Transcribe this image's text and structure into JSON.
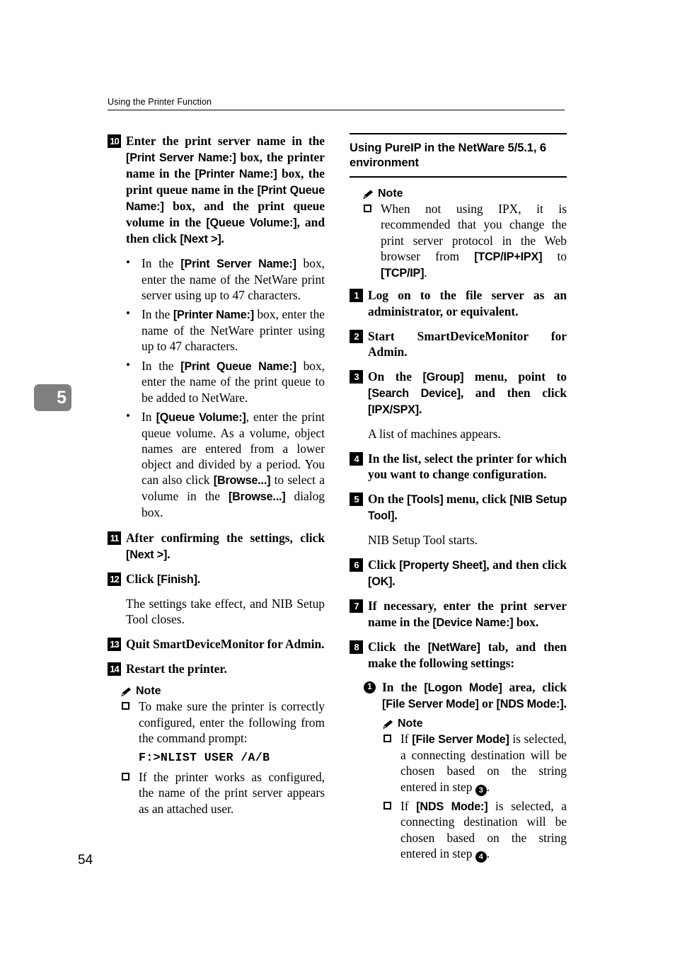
{
  "header": {
    "running_title": "Using the Printer Function"
  },
  "chapter_tab": {
    "number": "5"
  },
  "page_number": "54",
  "left_column": {
    "step10": {
      "badge": "10",
      "parts": [
        {
          "t": "Enter the print server name in the ",
          "s": "serif"
        },
        {
          "t": "[Print Server Name:]",
          "s": "ui"
        },
        {
          "t": " box, the printer name in the ",
          "s": "serif"
        },
        {
          "t": "[Printer Name:]",
          "s": "ui"
        },
        {
          "t": " box, the print queue name in the ",
          "s": "serif"
        },
        {
          "t": "[Print Queue Name:]",
          "s": "ui"
        },
        {
          "t": " box, and the print queue volume in the ",
          "s": "serif"
        },
        {
          "t": "[Queue Volume:]",
          "s": "ui"
        },
        {
          "t": ", and then click ",
          "s": "serif"
        },
        {
          "t": "[Next >]",
          "s": "ui"
        },
        {
          "t": ".",
          "s": "serif"
        }
      ]
    },
    "bullets": [
      [
        {
          "t": "In the ",
          "s": "serif"
        },
        {
          "t": "[Print Server Name:]",
          "s": "ui"
        },
        {
          "t": " box, enter the name of the NetWare print server using up to 47 characters.",
          "s": "serif"
        }
      ],
      [
        {
          "t": "In the ",
          "s": "serif"
        },
        {
          "t": "[Printer Name:]",
          "s": "ui"
        },
        {
          "t": " box, enter the name of the NetWare printer using up to 47 characters.",
          "s": "serif"
        }
      ],
      [
        {
          "t": "In the ",
          "s": "serif"
        },
        {
          "t": "[Print Queue Name:]",
          "s": "ui"
        },
        {
          "t": " box, enter the name of the print queue to be added to NetWare.",
          "s": "serif"
        }
      ],
      [
        {
          "t": "In ",
          "s": "serif"
        },
        {
          "t": "[Queue Volume:]",
          "s": "ui"
        },
        {
          "t": ", enter the print queue volume. As a volume, object names are entered from a lower object and divided by a period. You can also click ",
          "s": "serif"
        },
        {
          "t": "[Browse...]",
          "s": "ui"
        },
        {
          "t": " to select a volume in the ",
          "s": "serif"
        },
        {
          "t": "[Browse...]",
          "s": "ui"
        },
        {
          "t": " dialog box.",
          "s": "serif"
        }
      ]
    ],
    "step11": {
      "badge": "11",
      "parts": [
        {
          "t": "After confirming the settings, click ",
          "s": "serif"
        },
        {
          "t": "[Next >]",
          "s": "ui"
        },
        {
          "t": ".",
          "s": "serif"
        }
      ]
    },
    "step12": {
      "badge": "12",
      "parts": [
        {
          "t": "Click ",
          "s": "serif"
        },
        {
          "t": "[Finish]",
          "s": "ui"
        },
        {
          "t": ".",
          "s": "serif"
        }
      ],
      "result": "The settings take effect, and NIB Setup Tool closes."
    },
    "step13": {
      "badge": "13",
      "parts": [
        {
          "t": "Quit SmartDeviceMonitor for Admin.",
          "s": "serif"
        }
      ]
    },
    "step14": {
      "badge": "14",
      "parts": [
        {
          "t": "Restart the printer.",
          "s": "serif"
        }
      ]
    },
    "note": {
      "label": "Note",
      "icon": "pencil-icon",
      "items": [
        [
          {
            "t": "To make sure the printer is correctly configured, enter the following from the command prompt:",
            "s": "serif"
          }
        ],
        [
          {
            "t": "If the printer works as configured, the name of the print server appears as an attached user.",
            "s": "serif"
          }
        ]
      ],
      "command": "F:>NLIST USER /A/B"
    }
  },
  "right_column": {
    "heading": "Using PureIP in the NetWare 5/5.1, 6 environment",
    "note_top": {
      "label": "Note",
      "icon": "pencil-icon",
      "items": [
        [
          {
            "t": "When not using IPX, it is recommended that you change the print server protocol in the Web browser from ",
            "s": "serif"
          },
          {
            "t": "[TCP/IP+IPX]",
            "s": "ui"
          },
          {
            "t": " to ",
            "s": "serif"
          },
          {
            "t": "[TCP/IP]",
            "s": "ui"
          },
          {
            "t": ".",
            "s": "serif"
          }
        ]
      ]
    },
    "step1": {
      "badge": "1",
      "parts": [
        {
          "t": "Log on to the file server as an administrator, or equivalent.",
          "s": "serif"
        }
      ]
    },
    "step2": {
      "badge": "2",
      "parts": [
        {
          "t": "Start SmartDeviceMonitor for Admin.",
          "s": "serif"
        }
      ]
    },
    "step3": {
      "badge": "3",
      "parts": [
        {
          "t": "On the ",
          "s": "serif"
        },
        {
          "t": "[Group]",
          "s": "ui"
        },
        {
          "t": " menu, point to ",
          "s": "serif"
        },
        {
          "t": "[Search Device]",
          "s": "ui"
        },
        {
          "t": ", and then click ",
          "s": "serif"
        },
        {
          "t": "[IPX/SPX]",
          "s": "ui"
        },
        {
          "t": ".",
          "s": "serif"
        }
      ],
      "result": "A list of machines appears."
    },
    "step4": {
      "badge": "4",
      "parts": [
        {
          "t": "In the list, select the printer for which you want to change configuration.",
          "s": "serif"
        }
      ]
    },
    "step5": {
      "badge": "5",
      "parts": [
        {
          "t": "On the ",
          "s": "serif"
        },
        {
          "t": "[Tools]",
          "s": "ui"
        },
        {
          "t": " menu, click ",
          "s": "serif"
        },
        {
          "t": "[NIB Setup Tool]",
          "s": "ui"
        },
        {
          "t": ".",
          "s": "serif"
        }
      ],
      "result": "NIB Setup Tool starts."
    },
    "step6": {
      "badge": "6",
      "parts": [
        {
          "t": "Click ",
          "s": "serif"
        },
        {
          "t": "[Property Sheet]",
          "s": "ui"
        },
        {
          "t": ", and then click ",
          "s": "serif"
        },
        {
          "t": "[OK]",
          "s": "ui"
        },
        {
          "t": ".",
          "s": "serif"
        }
      ]
    },
    "step7": {
      "badge": "7",
      "parts": [
        {
          "t": "If necessary, enter the print server name in the ",
          "s": "serif"
        },
        {
          "t": "[Device Name:]",
          "s": "ui"
        },
        {
          "t": " box.",
          "s": "serif"
        }
      ]
    },
    "step8": {
      "badge": "8",
      "parts": [
        {
          "t": "Click the ",
          "s": "serif"
        },
        {
          "t": "[NetWare]",
          "s": "ui"
        },
        {
          "t": " tab, and then make the following settings:",
          "s": "serif"
        }
      ]
    },
    "substep1": {
      "badge": "1",
      "parts": [
        {
          "t": "In the ",
          "s": "serif"
        },
        {
          "t": "[Logon Mode]",
          "s": "ui"
        },
        {
          "t": " area, click ",
          "s": "serif"
        },
        {
          "t": "[File Server Mode]",
          "s": "ui"
        },
        {
          "t": " or ",
          "s": "serif"
        },
        {
          "t": "[NDS Mode:]",
          "s": "ui"
        },
        {
          "t": ".",
          "s": "serif"
        }
      ]
    },
    "note_bottom": {
      "label": "Note",
      "icon": "pencil-icon",
      "items": [
        [
          {
            "t": "If ",
            "s": "serif"
          },
          {
            "t": "[File Server Mode]",
            "s": "ui"
          },
          {
            "t": " is selected, a connecting destination will be chosen based on the string entered in step ",
            "s": "serif"
          },
          {
            "t": "3",
            "s": "circ"
          },
          {
            "t": ".",
            "s": "serif"
          }
        ],
        [
          {
            "t": "If ",
            "s": "serif"
          },
          {
            "t": "[NDS Mode:]",
            "s": "ui"
          },
          {
            "t": " is selected, a connecting destination will be chosen based on the string entered in step ",
            "s": "serif"
          },
          {
            "t": "4",
            "s": "circ"
          },
          {
            "t": ".",
            "s": "serif"
          }
        ]
      ]
    }
  }
}
